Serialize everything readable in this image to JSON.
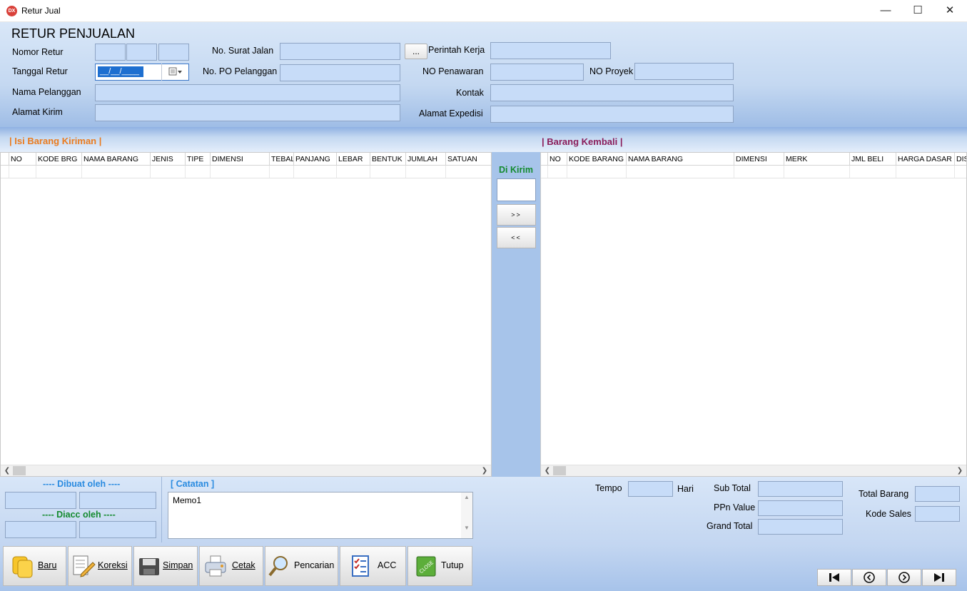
{
  "window": {
    "title": "Retur Jual",
    "icon_text": "DX",
    "btn_min": "—",
    "btn_max": "☐",
    "btn_close": "✕"
  },
  "form": {
    "title": "RETUR PENJUALAN",
    "nomor_retur_label": "Nomor Retur",
    "tanggal_retur_label": "Tanggal Retur",
    "tanggal_retur_value": "__/__/____",
    "nama_pelanggan_label": "Nama Pelanggan",
    "alamat_kirim_label": "Alamat Kirim",
    "no_surat_jalan_label": "No. Surat Jalan",
    "no_po_label": "No. PO Pelanggan",
    "browse_btn": "...",
    "perintah_kerja_label": "Perintah Kerja",
    "no_penawaran_label": "NO Penawaran",
    "no_proyek_label": "NO Proyek",
    "kontak_label": "Kontak",
    "alamat_expedisi_label": "Alamat Expedisi"
  },
  "left_grid": {
    "title": "| Isi Barang Kiriman |",
    "columns": [
      "NO",
      "KODE BRG",
      "NAMA BARANG",
      "JENIS",
      "TIPE",
      "DIMENSI",
      "TEBAL",
      "PANJANG",
      "LEBAR",
      "BENTUK",
      "JUMLAH",
      "SATUAN"
    ]
  },
  "right_grid": {
    "title": "| Barang Kembali |",
    "columns": [
      "NO",
      "KODE BARANG",
      "NAMA BARANG",
      "DIMENSI",
      "MERK",
      "JML BELI",
      "HARGA DASAR",
      "DIS"
    ]
  },
  "transfer": {
    "label": "Di Kirim",
    "forward": ">>",
    "back": "<<"
  },
  "signatures": {
    "dibuat_oleh": "---- Dibuat oleh ----",
    "diacc_oleh": "---- Diacc oleh ----"
  },
  "catatan": {
    "label": "[ Catatan ]",
    "memo": "Memo1"
  },
  "totals": {
    "tempo_label": "Tempo",
    "hari_label": "Hari",
    "sub_total_label": "Sub Total",
    "ppn_label": "PPn Value",
    "grand_total_label": "Grand Total",
    "total_barang_label": "Total Barang",
    "kode_sales_label": "Kode Sales"
  },
  "toolbar": {
    "baru": "Baru",
    "koreksi": "Koreksi",
    "simpan": "Simpan",
    "cetak": "Cetak",
    "pencarian": "Pencarian",
    "acc": "ACC",
    "tutup": "Tutup"
  },
  "icons": {
    "close_book_text": "CLOSE"
  }
}
